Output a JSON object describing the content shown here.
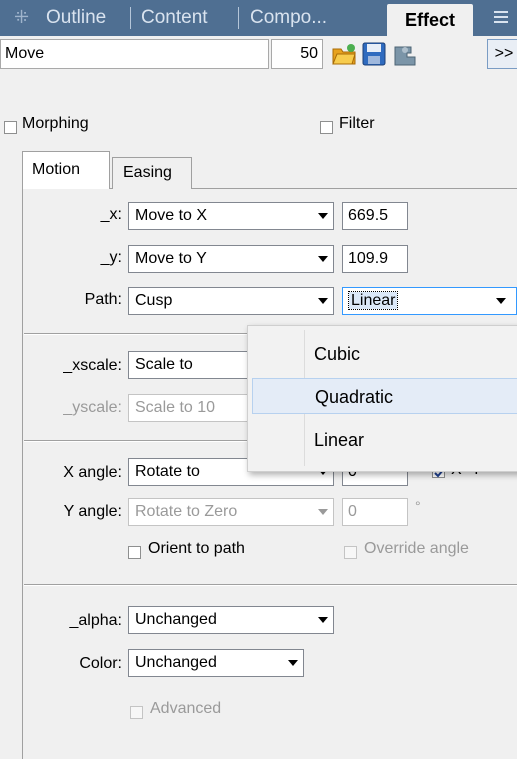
{
  "tabs": {
    "outline": "Outline",
    "content": "Content",
    "components": "Compo...",
    "effect": "Effect",
    "separator": "|"
  },
  "effect_row": {
    "name": "Move",
    "duration": "50",
    "more_label": ">>",
    "icons": [
      "open-folder-icon",
      "save-disk-icon",
      "puzzle-icon"
    ]
  },
  "options": {
    "morphing": "Morphing",
    "filter": "Filter"
  },
  "subtabs": {
    "motion": "Motion",
    "easing": "Easing"
  },
  "motion": {
    "x_label": "_x:",
    "x_mode": "Move to X",
    "x_value": "669.5",
    "y_label": "_y:",
    "y_mode": "Move to Y",
    "y_value": "109.9",
    "path_label": "Path:",
    "path_mode": "Cusp",
    "interpolation": "Linear",
    "xscale_label": "_xscale:",
    "xscale_mode": "Scale to",
    "yscale_label": "_yscale:",
    "yscale_mode": "Scale to 10",
    "xangle_label": "X angle:",
    "xangle_mode": "Rotate to",
    "xangle_value": "0",
    "xequal_label": "X=Y",
    "yangle_label": "Y angle:",
    "yangle_mode": "Rotate to Zero",
    "yangle_value": "0",
    "degree_symbol": "°",
    "orient_label": "Orient to path",
    "override_label": "Override angle",
    "alpha_label": "_alpha:",
    "alpha_mode": "Unchanged",
    "color_label": "Color:",
    "color_mode": "Unchanged",
    "advanced_label": "Advanced"
  },
  "interp_popup": {
    "items": [
      "Cubic",
      "Quadratic",
      "Linear"
    ],
    "hovered": "Quadratic"
  },
  "colors": {
    "tabbar": "#4f6f92",
    "accent": "#3399ff"
  }
}
